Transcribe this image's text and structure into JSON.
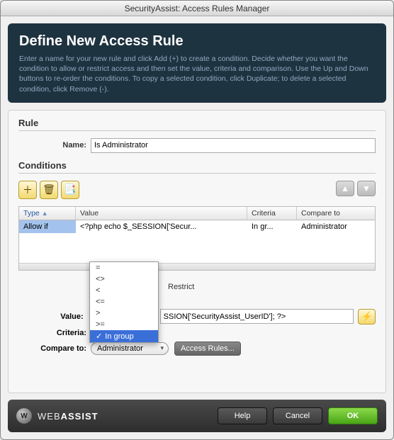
{
  "window": {
    "title": "SecurityAssist: Access Rules Manager"
  },
  "header": {
    "title": "Define New Access Rule",
    "desc": "Enter a name for your new rule and click Add (+) to create a condition. Decide whether you want the condition to allow or restrict access and then set the value, criteria and comparison. Use the Up and Down buttons to re-order the conditions. To copy a selected condition, click Duplicate; to delete a selected condition, click Remove (-)."
  },
  "rule": {
    "section": "Rule",
    "name_label": "Name:",
    "name_value": "Is Administrator"
  },
  "conditions": {
    "section": "Conditions",
    "columns": {
      "type": "Type",
      "value": "Value",
      "criteria": "Criteria",
      "compare": "Compare to"
    },
    "rows": [
      {
        "type": "Allow if",
        "value": "<?php echo $_SESSION['Secur...",
        "criteria": "In gr...",
        "compare": "Administrator"
      }
    ],
    "restrict_label": "Restrict",
    "dropdown": {
      "options": [
        "=",
        "<>",
        "<",
        "<=",
        ">",
        ">=",
        "In group"
      ],
      "selected": "In group"
    },
    "value_label": "Value:",
    "value_field": "SSION['SecurityAssist_UserID']; ?>",
    "criteria_label": "Criteria:",
    "compare_label": "Compare to:",
    "compare_value": "Administrator",
    "access_rules_btn": "Access Rules..."
  },
  "icons": {
    "add": "＋",
    "remove": "🗑",
    "duplicate": "📑",
    "up": "▲",
    "down": "▼",
    "lightning": "⚡"
  },
  "footer": {
    "brand_light": "WEB",
    "brand_bold": "ASSIST",
    "help": "Help",
    "cancel": "Cancel",
    "ok": "OK"
  }
}
